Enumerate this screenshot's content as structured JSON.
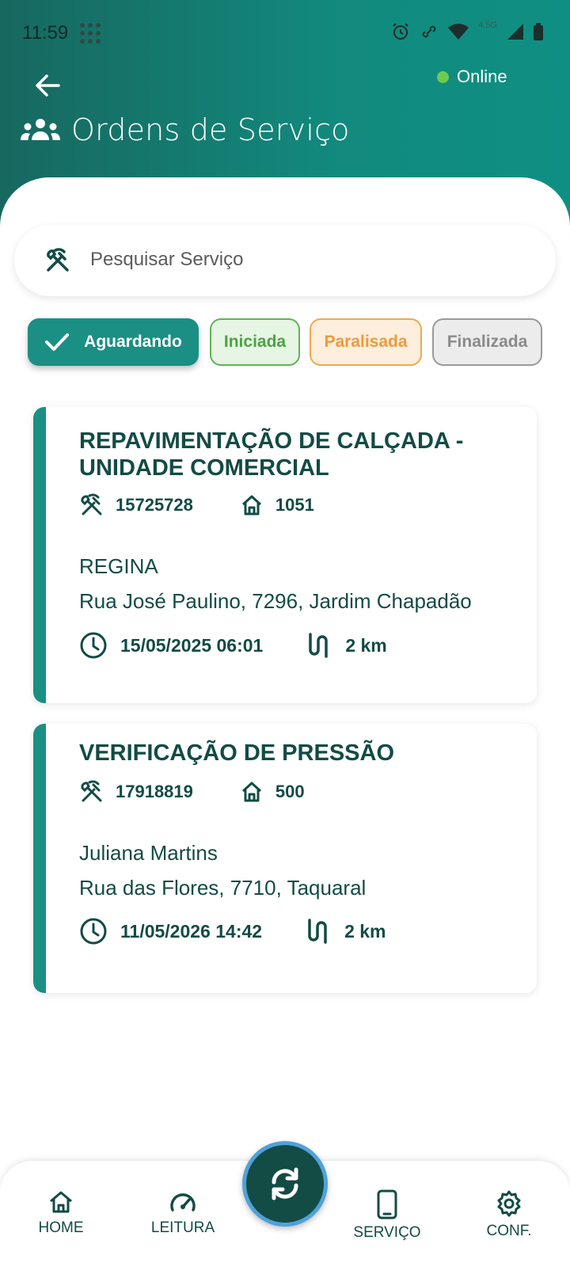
{
  "status_bar": {
    "time": "11:59",
    "network": "4.5G"
  },
  "header": {
    "title": "Ordens de Serviço",
    "online_label": "Online"
  },
  "search": {
    "placeholder": "Pesquisar Serviço"
  },
  "filters": [
    {
      "label": "Aguardando",
      "selected": true,
      "color": "#1b8f84"
    },
    {
      "label": "Iniciada",
      "selected": false,
      "color": "#5fb554"
    },
    {
      "label": "Paralisada",
      "selected": false,
      "color": "#f0a94e"
    },
    {
      "label": "Finalizada",
      "selected": false,
      "color": "#9a9a9a"
    }
  ],
  "orders": [
    {
      "title": "REPAVIMENTAÇÃO DE CALÇADA - UNIDADE COMERCIAL",
      "service_number": "15725728",
      "unit_number": "1051",
      "client": "REGINA",
      "address": "Rua José Paulino, 7296, Jardim Chapadão",
      "datetime": "15/05/2025 06:01",
      "distance": "2 km"
    },
    {
      "title": "VERIFICAÇÃO DE PRESSÃO",
      "service_number": "17918819",
      "unit_number": "500",
      "client": "Juliana Martins",
      "address": "Rua das Flores, 7710, Taquaral",
      "datetime": "11/05/2026 14:42",
      "distance": "2 km"
    }
  ],
  "bottom_nav": {
    "home": "HOME",
    "leitura": "LEITURA",
    "servico": "SERVIÇO",
    "conf": "CONF."
  },
  "colors": {
    "primary": "#1b8f84",
    "dark": "#134b45",
    "online": "#6ccb4d"
  }
}
